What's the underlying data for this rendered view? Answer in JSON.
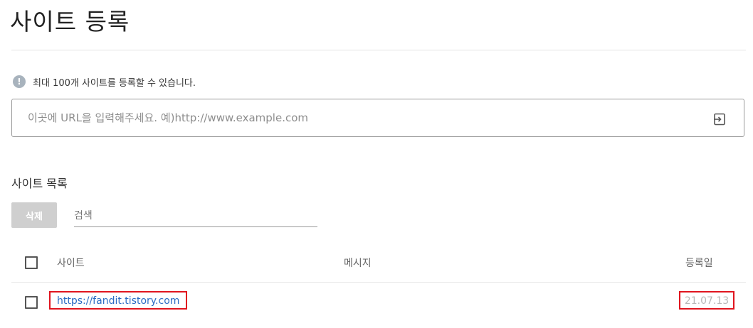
{
  "header": {
    "title": "사이트 등록"
  },
  "notice": {
    "icon": "info-icon",
    "icon_glyph": "!",
    "text": "최대 100개 사이트를 등록할 수 있습니다."
  },
  "url_input": {
    "value": "",
    "placeholder": "이곳에 URL을 입력해주세요. 예)http://www.example.com",
    "submit_icon": "enter-icon"
  },
  "site_list": {
    "title": "사이트 목록",
    "delete_label": "삭제",
    "search": {
      "value": "",
      "placeholder": "검색"
    },
    "columns": {
      "site": "사이트",
      "message": "메시지",
      "registered": "등록일"
    },
    "rows": [
      {
        "checked": false,
        "url": "https://fandit.tistory.com",
        "message": "",
        "date": "21.07.13"
      }
    ]
  },
  "colors": {
    "link": "#2b6cc4",
    "highlight_border": "#e0141e",
    "disabled_button": "#cfcfcf",
    "info_icon": "#a8b3bd"
  }
}
